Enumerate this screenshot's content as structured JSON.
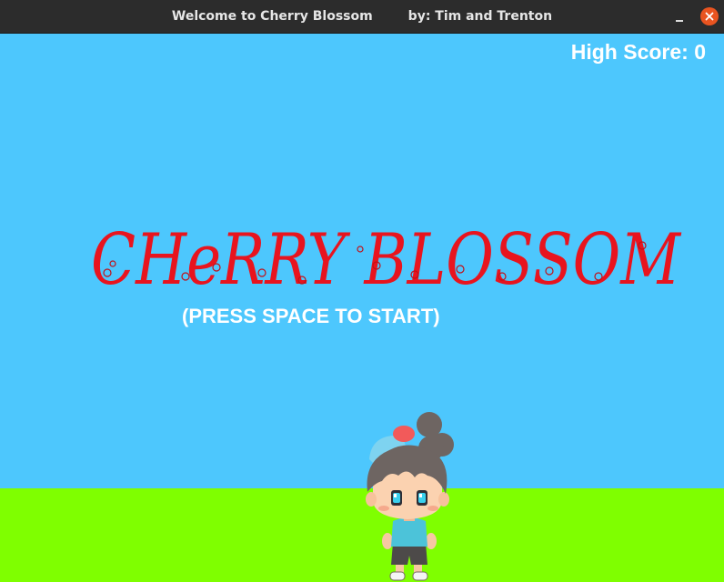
{
  "window": {
    "title": "Welcome to Cherry Blossom        by: Tim and Trenton"
  },
  "game": {
    "high_score_label": "High Score: 0",
    "title": "CHeRRY BLOSSOM",
    "prompt": "(PRESS SPACE TO START)"
  },
  "colors": {
    "sky": "#4dc7fd",
    "ground": "#7fff00",
    "title": "#e8141e",
    "close_button": "#e95420"
  },
  "icons": {
    "minimize": "minimize-icon",
    "close": "close-icon"
  }
}
